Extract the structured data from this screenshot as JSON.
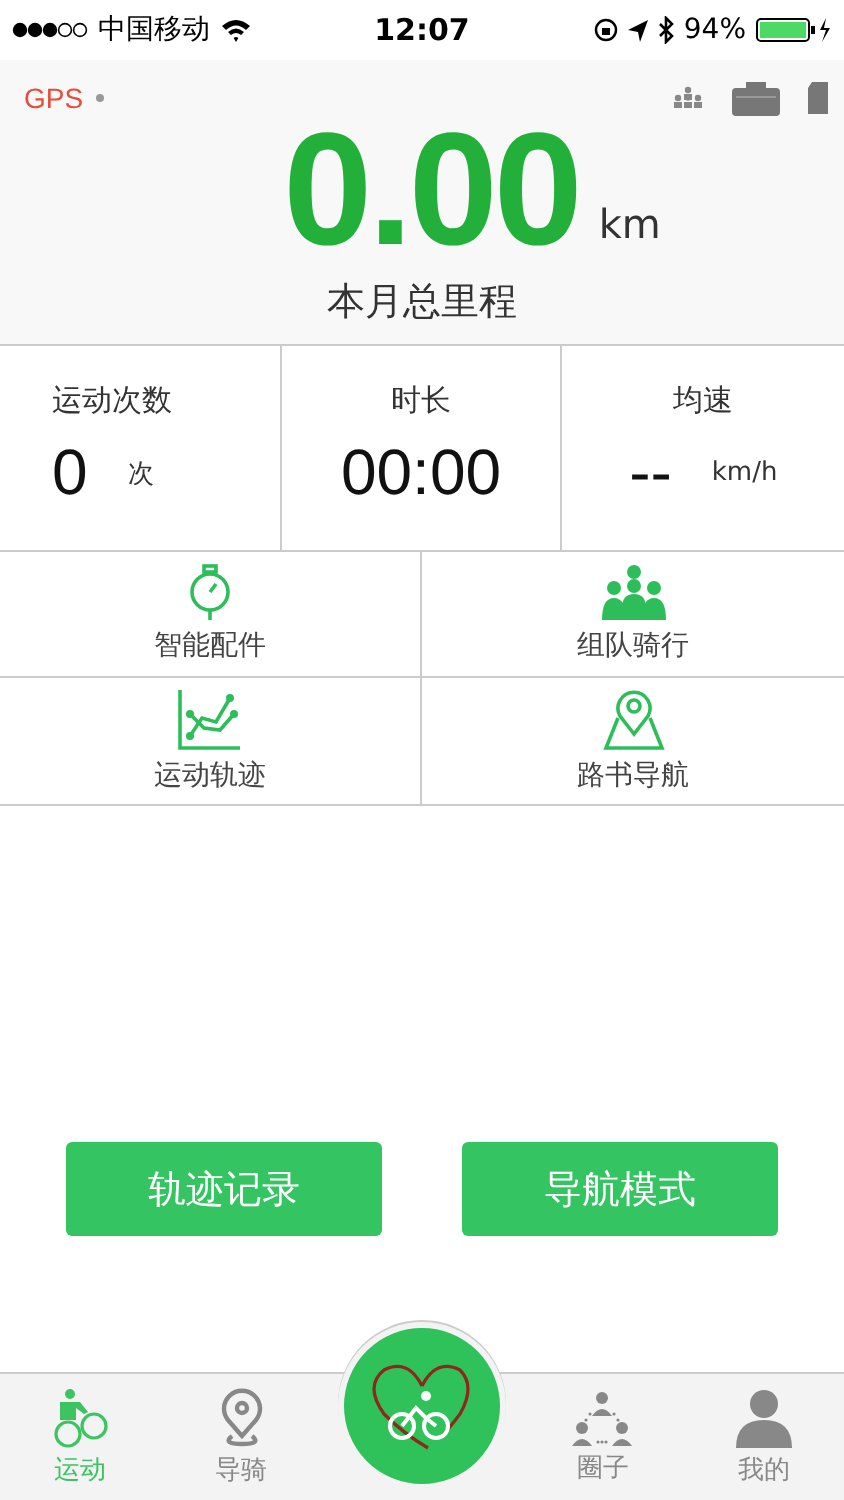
{
  "status_bar": {
    "carrier": "中国移动",
    "time": "12:07",
    "battery": "94%"
  },
  "header": {
    "gps": "GPS",
    "distance": "0.00",
    "unit": "km",
    "caption": "本月总里程"
  },
  "stats": [
    {
      "label": "运动次数",
      "value": "0",
      "unit": "次"
    },
    {
      "label": "时长",
      "value": "00:00"
    },
    {
      "label": "均速",
      "value": "--",
      "unit": "km/h"
    }
  ],
  "features": [
    {
      "label": "智能配件",
      "kind": "stopwatch"
    },
    {
      "label": "组队骑行",
      "kind": "team"
    },
    {
      "label": "运动轨迹",
      "kind": "track"
    },
    {
      "label": "路书导航",
      "kind": "map"
    }
  ],
  "buttons": [
    "轨迹记录",
    "导航模式"
  ],
  "tabs": [
    {
      "label": "运动",
      "kind": "cyclist",
      "selected": true
    },
    {
      "label": "导骑",
      "kind": "pin",
      "selected": false
    },
    {
      "kind": "center",
      "selected": false
    },
    {
      "label": "圈子",
      "kind": "circle",
      "selected": false
    },
    {
      "label": "我的",
      "kind": "person",
      "selected": false
    }
  ]
}
